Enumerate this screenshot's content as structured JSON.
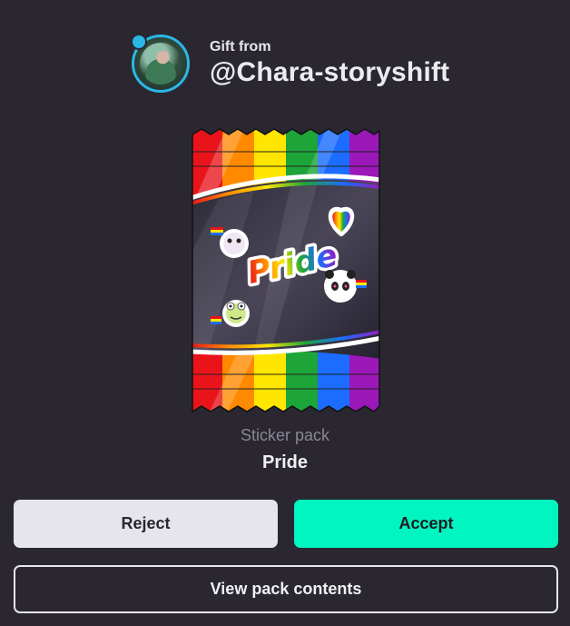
{
  "gift": {
    "from_label": "Gift from",
    "username": "@Chara-storyshift"
  },
  "pack": {
    "type_label": "Sticker pack",
    "name": "Pride",
    "stickers": [
      "flag-ghost-sticker",
      "pride-text-sticker",
      "rainbow-heart-sticker",
      "panda-flag-sticker",
      "frog-flag-sticker"
    ],
    "sticker_text": "Pride",
    "stripe_colors": [
      "#e8141a",
      "#ff8a00",
      "#ffe600",
      "#1ea53a",
      "#1c6dff",
      "#9b18b8"
    ]
  },
  "actions": {
    "reject_label": "Reject",
    "accept_label": "Accept",
    "view_label": "View pack contents"
  },
  "colors": {
    "background": "#2a2731",
    "accept": "#00f5c0",
    "reject": "#e6e4ec",
    "avatar_ring": "#2bb7e6"
  }
}
